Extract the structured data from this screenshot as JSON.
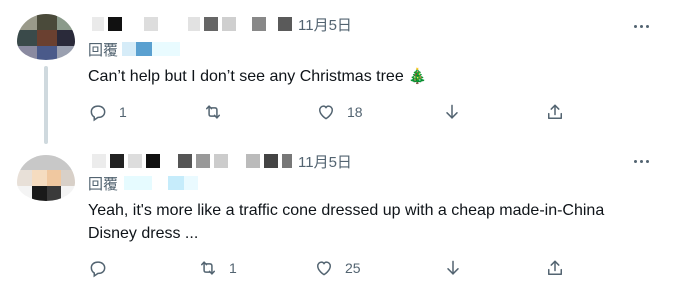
{
  "colors": {
    "text_primary": "#0f1419",
    "text_secondary": "#536471",
    "thread_line": "#cfd9de",
    "reply_link_blur": "#a7d8f0"
  },
  "tweets": [
    {
      "date": "11月5日",
      "reply_prefix": "回覆",
      "text": "Can’t help but I don’t see any Christmas tree",
      "emoji": "🎄",
      "more_icon": "more-horizontal-icon",
      "actions": {
        "reply": {
          "icon": "reply-icon",
          "count": "1"
        },
        "retweet": {
          "icon": "retweet-icon",
          "count": ""
        },
        "like": {
          "icon": "heart-icon",
          "count": "18"
        },
        "views": {
          "icon": "views-icon",
          "count": ""
        },
        "share": {
          "icon": "share-icon",
          "count": ""
        }
      }
    },
    {
      "date": "11月5日",
      "reply_prefix": "回覆",
      "text_line1": "Yeah, it's more like a traffic cone dressed up with a cheap made-in-China",
      "text_line2": "Disney dress ...",
      "more_icon": "more-horizontal-icon",
      "actions": {
        "reply": {
          "icon": "reply-icon",
          "count": ""
        },
        "retweet": {
          "icon": "retweet-icon",
          "count": "1"
        },
        "like": {
          "icon": "heart-icon",
          "count": "25"
        },
        "views": {
          "icon": "views-icon",
          "count": ""
        },
        "share": {
          "icon": "share-icon",
          "count": ""
        }
      }
    }
  ]
}
